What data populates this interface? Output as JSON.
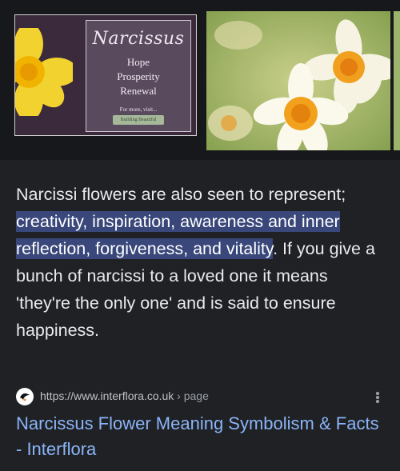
{
  "images": {
    "card": {
      "title": "Narcissus",
      "lines": [
        "Hope",
        "Prosperity",
        "Renewal"
      ],
      "small": "For more, visit...",
      "logo_text": "Building Beautiful"
    }
  },
  "snippet": {
    "before": "Narcissi flowers are also seen to represent; ",
    "highlight": "creativity, inspiration, awareness and inner reflection, forgiveness, and vitality",
    "after": ". If you give a bunch of narcissi to a loved one it means 'they're the only one' and is said to ensure happiness."
  },
  "source": {
    "url": "https://www.interflora.co.uk",
    "path": " › page",
    "favicon": "interflora-icon",
    "menu_icon": "more-vert-icon"
  },
  "result": {
    "title": "Narcissus Flower Meaning Symbolism & Facts - Interflora"
  },
  "colors": {
    "background": "#202124",
    "highlight": "#39477a",
    "link": "#8ab4f8"
  }
}
